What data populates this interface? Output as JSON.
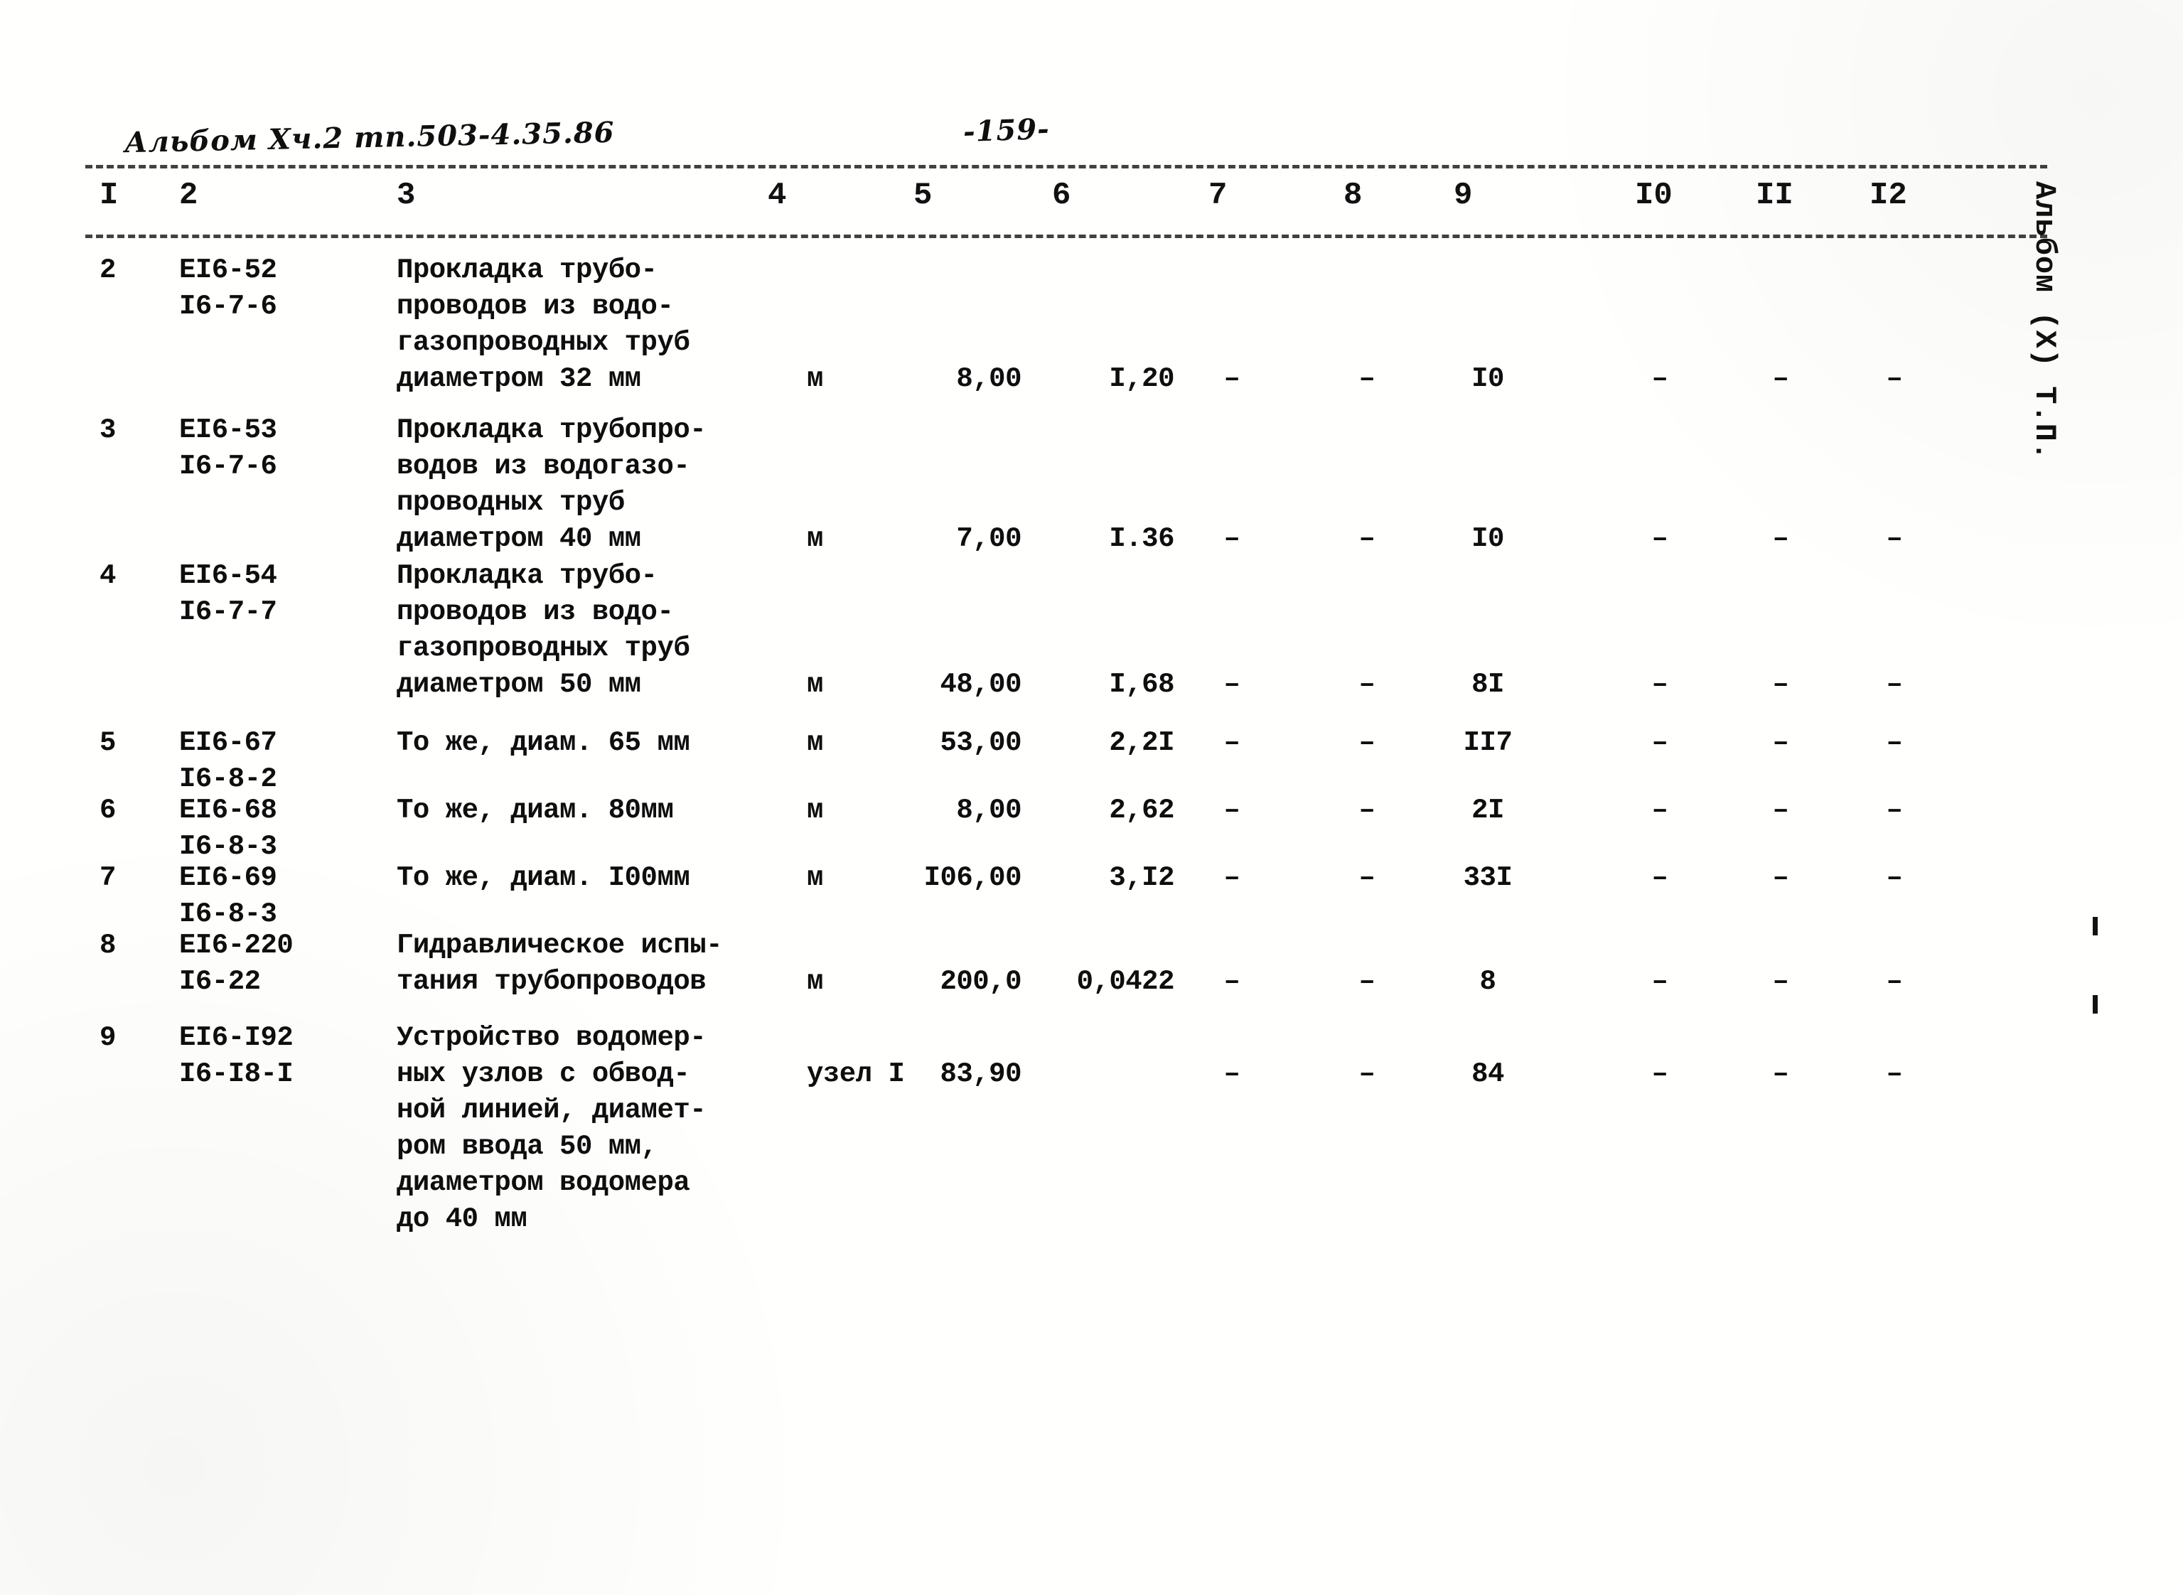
{
  "document": {
    "album_code_handwritten": "Альбом Xч.2 тп.503-4.35.86",
    "page_number_handwritten": "-159-",
    "margin_label": "Альбом (X) Т.П."
  },
  "table": {
    "column_headers": [
      "I",
      "2",
      "3",
      "4",
      "5",
      "6",
      "7",
      "8",
      "9",
      "I0",
      "II",
      "I2"
    ],
    "rows": [
      {
        "num": "2",
        "code_line1": "ЕI6-52",
        "code_line2": "I6-7-6",
        "desc_line1": "Прокладка трубо-",
        "desc_line2": "проводов из водо-",
        "desc_line3": "газопроводных труб",
        "desc_line4": "диаметром 32 мм",
        "unit": "м",
        "qty": "8,00",
        "price": "I,20",
        "c7": "–",
        "c8": "–",
        "c9": "I0",
        "c10": "–",
        "c11": "–",
        "c12": "–"
      },
      {
        "num": "3",
        "code_line1": "ЕI6-53",
        "code_line2": "I6-7-6",
        "desc_line1": "Прокладка трубопро-",
        "desc_line2": "водов из водогазо-",
        "desc_line3": "проводных труб",
        "desc_line4": "диаметром 40 мм",
        "unit": "м",
        "qty": "7,00",
        "price": "I.36",
        "c7": "–",
        "c8": "–",
        "c9": "I0",
        "c10": "–",
        "c11": "–",
        "c12": "–"
      },
      {
        "num": "4",
        "code_line1": "ЕI6-54",
        "code_line2": "I6-7-7",
        "desc_line1": "Прокладка трубо-",
        "desc_line2": "проводов из водо-",
        "desc_line3": "газопроводных труб",
        "desc_line4": "диаметром 50 мм",
        "unit": "м",
        "qty": "48,00",
        "price": "I,68",
        "c7": "–",
        "c8": "–",
        "c9": "8I",
        "c10": "–",
        "c11": "–",
        "c12": "–"
      },
      {
        "num": "5",
        "code_line1": "ЕI6-67",
        "code_line2": "I6-8-2",
        "desc_line1": "То же, диам. 65 мм",
        "desc_line2": "",
        "desc_line3": "",
        "desc_line4": "",
        "unit": "м",
        "qty": "53,00",
        "price": "2,2I",
        "c7": "–",
        "c8": "–",
        "c9": "II7",
        "c10": "–",
        "c11": "–",
        "c12": "–"
      },
      {
        "num": "6",
        "code_line1": "ЕI6-68",
        "code_line2": "I6-8-3",
        "desc_line1": "То же, диам. 80мм",
        "desc_line2": "",
        "desc_line3": "",
        "desc_line4": "",
        "unit": "м",
        "qty": "8,00",
        "price": "2,62",
        "c7": "–",
        "c8": "–",
        "c9": "2I",
        "c10": "–",
        "c11": "–",
        "c12": "–"
      },
      {
        "num": "7",
        "code_line1": "ЕI6-69",
        "code_line2": "I6-8-3",
        "desc_line1": "То же, диам. I00мм",
        "desc_line2": "",
        "desc_line3": "",
        "desc_line4": "",
        "unit": "м",
        "qty": "I06,00",
        "price": "3,I2",
        "c7": "–",
        "c8": "–",
        "c9": "33I",
        "c10": "–",
        "c11": "–",
        "c12": "–"
      },
      {
        "num": "8",
        "code_line1": "ЕI6-220",
        "code_line2": "I6-22",
        "desc_line1": "Гидравлическое испы-",
        "desc_line2": "тания трубопроводов",
        "desc_line3": "",
        "desc_line4": "",
        "unit": "м",
        "qty": "200,0",
        "price": "0,0422",
        "c7": "–",
        "c8": "–",
        "c9": "8",
        "c10": "–",
        "c11": "–",
        "c12": "–"
      },
      {
        "num": "9",
        "code_line1": "ЕI6-I92",
        "code_line2": "I6-I8-I",
        "desc_line1": "Устройство водомер-",
        "desc_line2": "ных узлов с обвод-",
        "desc_line3": "ной линией, диамет-",
        "desc_line4": "ром ввода 50 мм,",
        "desc_line5": "диаметром водомера",
        "desc_line6": "до 40 мм",
        "unit": "узел I",
        "qty": "83,90",
        "price": "",
        "c7": "–",
        "c8": "–",
        "c9": "84",
        "c10": "–",
        "c11": "–",
        "c12": "–"
      }
    ]
  }
}
